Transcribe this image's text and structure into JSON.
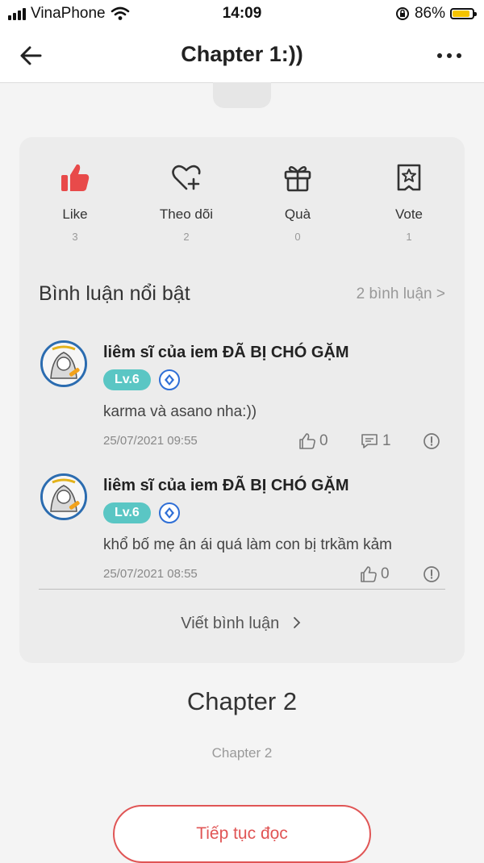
{
  "status_bar": {
    "carrier": "VinaPhone",
    "time": "14:09",
    "battery": "86%"
  },
  "nav": {
    "title": "Chapter 1:))"
  },
  "actions": [
    {
      "label": "Like",
      "count": "3",
      "icon": "thumbs-up-icon"
    },
    {
      "label": "Theo dõi",
      "count": "2",
      "icon": "heart-plus-icon"
    },
    {
      "label": "Quà",
      "count": "0",
      "icon": "gift-icon"
    },
    {
      "label": "Vote",
      "count": "1",
      "icon": "vote-badge-icon"
    }
  ],
  "comments_section": {
    "title": "Bình luận nổi bật",
    "count_link": "2 bình luận >",
    "write_label": "Viết bình luận",
    "items": [
      {
        "author": "liêm sĩ của iem ĐÃ BỊ CHÓ GẶM",
        "level": "Lv.6",
        "text": "karma và asano nha:))",
        "date": "25/07/2021 09:55",
        "likes": "0",
        "replies": "1"
      },
      {
        "author": "liêm sĩ của iem ĐÃ BỊ CHÓ GẶM",
        "level": "Lv.6",
        "text": "khổ bố mẹ ân ái quá làm con bị trkầm kảm",
        "date": "25/07/2021 08:55",
        "likes": "0"
      }
    ]
  },
  "next_chapter": {
    "title": "Chapter 2",
    "subtitle": "Chapter 2",
    "continue_label": "Tiếp tục đọc"
  },
  "colors": {
    "accent": "#e05555",
    "like": "#e84a4a",
    "level_badge": "#5ac6c4"
  }
}
